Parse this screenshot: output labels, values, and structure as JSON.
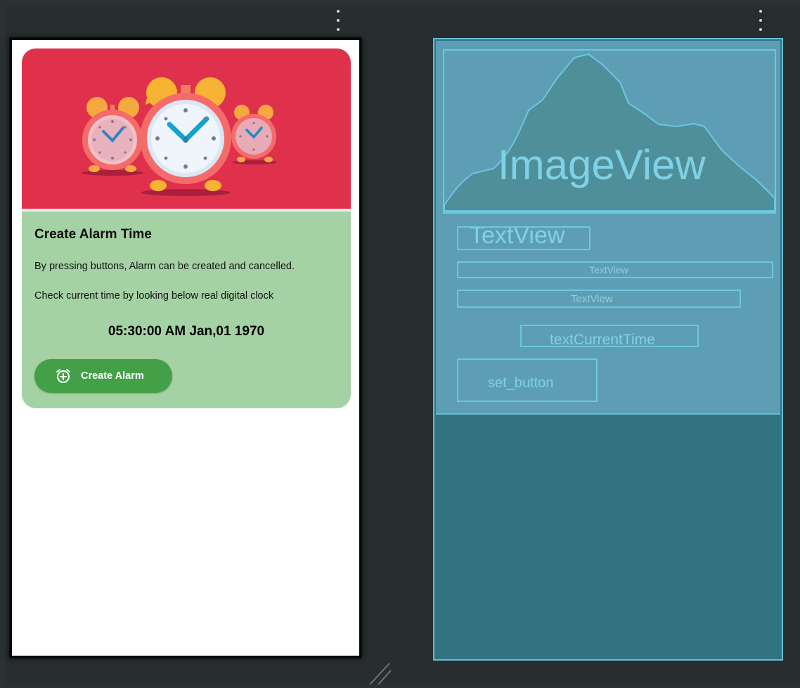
{
  "colors": {
    "canvas_bg": "#282d2f",
    "card_header": "#e0314c",
    "card_body": "#a5d2a5",
    "button": "#43a047",
    "blueprint_card": "#5e9eb4",
    "blueprint_bg": "#317381",
    "blueprint_outline": "#64bfd9"
  },
  "toolbar": {
    "left_menu_icon": "more-vert-icon",
    "right_menu_icon": "more-vert-icon"
  },
  "design": {
    "image_icon": "alarm-clocks-illustration",
    "title": "Create Alarm Time",
    "description": "By pressing buttons, Alarm can be created and cancelled.",
    "hint": "Check current time by looking below real digital clock",
    "current_time": "05:30:00 AM Jan,01 1970",
    "button": {
      "label": "Create Alarm",
      "icon": "add-alarm-icon"
    }
  },
  "blueprint": {
    "image_label": "ImageView",
    "title_label": "TextView",
    "description_label": "TextView",
    "hint_label": "TextView",
    "time_label": "textCurrentTime",
    "button_label": "set_button"
  }
}
